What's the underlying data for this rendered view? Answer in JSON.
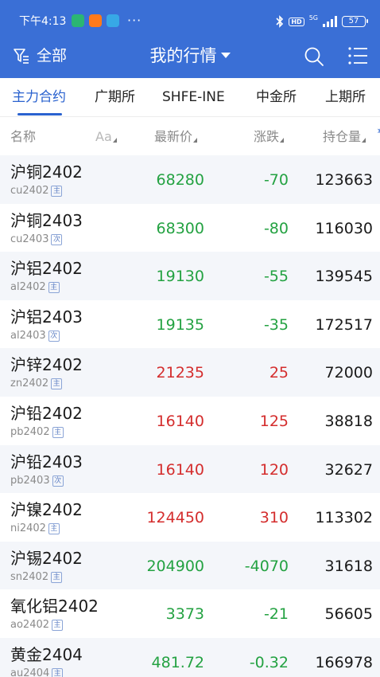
{
  "status_bar": {
    "time": "下午4:13",
    "more": "···",
    "battery": "57",
    "hd_label": "HD",
    "network": "5G"
  },
  "header": {
    "filter_label": "全部",
    "title": "我的行情"
  },
  "tabs": [
    {
      "label": "主力合约",
      "active": true
    },
    {
      "label": "广期所",
      "active": false
    },
    {
      "label": "SHFE-INE",
      "active": false
    },
    {
      "label": "中金所",
      "active": false
    },
    {
      "label": "上期所",
      "active": false
    }
  ],
  "columns": {
    "name": "名称",
    "font_toggle": "Aa",
    "price": "最新价",
    "change": "涨跌",
    "open_interest": "持仓量"
  },
  "rows": [
    {
      "name": "沪铜2402",
      "code": "cu2402",
      "tag": "主",
      "price": "68280",
      "change": "-70",
      "oi": "123663",
      "dir": "down"
    },
    {
      "name": "沪铜2403",
      "code": "cu2403",
      "tag": "次",
      "price": "68300",
      "change": "-80",
      "oi": "116030",
      "dir": "down"
    },
    {
      "name": "沪铝2402",
      "code": "al2402",
      "tag": "主",
      "price": "19130",
      "change": "-55",
      "oi": "139545",
      "dir": "down"
    },
    {
      "name": "沪铝2403",
      "code": "al2403",
      "tag": "次",
      "price": "19135",
      "change": "-35",
      "oi": "172517",
      "dir": "down"
    },
    {
      "name": "沪锌2402",
      "code": "zn2402",
      "tag": "主",
      "price": "21235",
      "change": "25",
      "oi": "72000",
      "dir": "up"
    },
    {
      "name": "沪铅2402",
      "code": "pb2402",
      "tag": "主",
      "price": "16140",
      "change": "125",
      "oi": "38818",
      "dir": "up"
    },
    {
      "name": "沪铅2403",
      "code": "pb2403",
      "tag": "次",
      "price": "16140",
      "change": "120",
      "oi": "32627",
      "dir": "up"
    },
    {
      "name": "沪镍2402",
      "code": "ni2402",
      "tag": "主",
      "price": "124450",
      "change": "310",
      "oi": "113302",
      "dir": "up"
    },
    {
      "name": "沪锡2402",
      "code": "sn2402",
      "tag": "主",
      "price": "204900",
      "change": "-4070",
      "oi": "31618",
      "dir": "down"
    },
    {
      "name": "氧化铝2402",
      "code": "ao2402",
      "tag": "主",
      "price": "3373",
      "change": "-21",
      "oi": "56605",
      "dir": "down"
    },
    {
      "name": "黄金2404",
      "code": "au2404",
      "tag": "主",
      "price": "481.72",
      "change": "-0.32",
      "oi": "166978",
      "dir": "down"
    }
  ],
  "colors": {
    "header_blue": "#3a6fd6",
    "accent_blue": "#2a62cf",
    "up_red": "#d42d2d",
    "down_green": "#24a242"
  }
}
